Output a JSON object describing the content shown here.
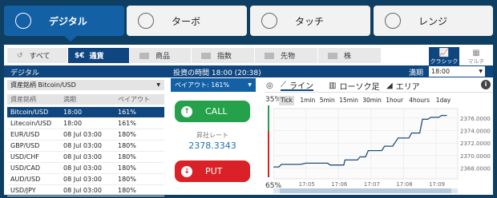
{
  "modes": [
    {
      "label": "デジタル",
      "active": true
    },
    {
      "label": "ターボ",
      "active": false
    },
    {
      "label": "タッチ",
      "active": false
    },
    {
      "label": "レンジ",
      "active": false
    }
  ],
  "categories": [
    {
      "icon": "↺",
      "label": "すべて",
      "active": false
    },
    {
      "icon": "$€",
      "label": "通貨",
      "active": true
    },
    {
      "icon": "",
      "label": "商品",
      "active": false
    },
    {
      "icon": "",
      "label": "指数",
      "active": false
    },
    {
      "icon": "",
      "label": "先物",
      "active": false
    },
    {
      "icon": "",
      "label": "株",
      "active": false
    }
  ],
  "views": [
    {
      "label": "クラシック",
      "active": true
    },
    {
      "label": "マルチ",
      "active": false
    }
  ],
  "bar": {
    "title": "デジタル",
    "time": "投資の時間 18:00 (20:38)",
    "expiry_label": "満期",
    "expiry_value": "18:00"
  },
  "asset_select": "資産銘柄 Bitcoin/USD",
  "list_headers": {
    "asset": "資産銘柄",
    "expiry": "満期",
    "payout": "ペイアウト"
  },
  "assets": [
    {
      "asset": "Bitcoin/USD",
      "expiry": "18:00",
      "payout": "161%",
      "selected": true
    },
    {
      "asset": "Litecoin/USD",
      "expiry": "18:00",
      "payout": "161%",
      "selected": false
    },
    {
      "asset": "EUR/USD",
      "expiry": "08 Jul 03:00",
      "payout": "180%",
      "selected": false
    },
    {
      "asset": "GBP/USD",
      "expiry": "08 Jul 03:00",
      "payout": "180%",
      "selected": false
    },
    {
      "asset": "USD/CHF",
      "expiry": "08 Jul 03:00",
      "payout": "180%",
      "selected": false
    },
    {
      "asset": "USD/CAD",
      "expiry": "08 Jul 03:00",
      "payout": "180%",
      "selected": false
    },
    {
      "asset": "AUD/USD",
      "expiry": "08 Jul 03:00",
      "payout": "180%",
      "selected": false
    },
    {
      "asset": "USD/JPY",
      "expiry": "08 Jul 03:00",
      "payout": "180%",
      "selected": false
    }
  ],
  "trade": {
    "payout_label": "ペイアウト: 161%",
    "call_label": "CALL",
    "put_label": "PUT",
    "rate_label": "昇社レート",
    "rate_value": "2378.3343"
  },
  "chart_controls": {
    "line_label": "ライン",
    "candle_label": "ローソク足",
    "area_label": "エリア"
  },
  "intervals": [
    {
      "label": "Tick",
      "active": true
    },
    {
      "label": "1min",
      "active": false
    },
    {
      "label": "5min",
      "active": false
    },
    {
      "label": "15min",
      "active": false
    },
    {
      "label": "30min",
      "active": false
    },
    {
      "label": "1hour",
      "active": false
    },
    {
      "label": "4hours",
      "active": false
    },
    {
      "label": "1day",
      "active": false
    }
  ],
  "sentiment": {
    "up": "35%",
    "down": "65%",
    "up_fraction": 0.35,
    "colors": {
      "up": "#24a14a",
      "down": "#d92127"
    }
  },
  "chart_data": {
    "type": "line",
    "x": [
      "17:03:00",
      "17:04:10",
      "17:04:15",
      "17:04:50",
      "17:05:00",
      "17:05:40",
      "17:05:45",
      "17:06:10",
      "17:06:12",
      "17:06:35",
      "17:06:40",
      "17:06:50",
      "17:06:55",
      "17:07:20",
      "17:07:25",
      "17:07:40",
      "17:07:50",
      "17:08:10",
      "17:08:15",
      "17:08:30",
      "17:08:35",
      "17:08:45",
      "17:08:50",
      "17:09:05",
      "17:09:10",
      "17:09:20"
    ],
    "y": [
      2368.2,
      2368.2,
      2368.6,
      2368.6,
      2368.8,
      2368.8,
      2368.5,
      2368.5,
      2369.3,
      2369.3,
      2369.8,
      2369.8,
      2370.8,
      2370.8,
      2371.5,
      2371.5,
      2372.8,
      2372.8,
      2373.6,
      2373.6,
      2375.8,
      2375.8,
      2376.1,
      2376.1,
      2376.4,
      2376.4
    ],
    "xticks": [
      "17:05",
      "17:06",
      "17:07",
      "17:08",
      "17:09"
    ],
    "yticks": [
      "2376.0000",
      "2374.0000",
      "2372.0000",
      "2370.0000",
      "2368.0000"
    ],
    "ylim": [
      2366.3,
      2377.5
    ],
    "color": "#1f4e79"
  }
}
